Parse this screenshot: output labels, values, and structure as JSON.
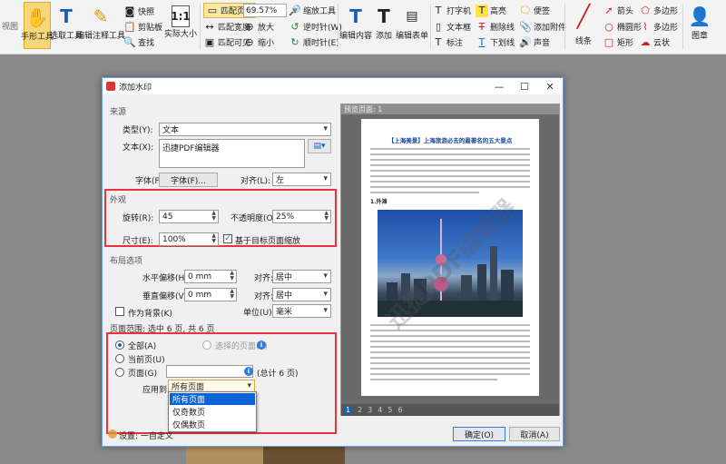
{
  "ribbon": {
    "view_label": "视图",
    "hand_tool": "手形工具",
    "select_tool": "选取工具",
    "annot_select_tool": "编辑注释工具",
    "snapshot": "快照",
    "clipboard": "剪贴板",
    "find": "查找",
    "actual_size": "实际大小",
    "fit_page": "匹配页面",
    "fit_width": "匹配宽度",
    "fit_visible": "匹配可见",
    "zoom_value": "69.57%",
    "zoom_tool": "缩放工具",
    "zoom_in": "放大",
    "zoom_out": "缩小",
    "rotate_ccw": "逆时针(W)",
    "rotate_cw": "顺时针(E)",
    "edit_content": "编辑内容",
    "add": "添加",
    "edit_form": "编辑表单",
    "typewriter": "打字机",
    "textbox": "文本框",
    "callout": "标注",
    "highlight": "高亮",
    "strikeout": "删除线",
    "underline": "下划线",
    "note": "便签",
    "attach": "添加附件",
    "sound": "声音",
    "line": "线条",
    "arrow": "箭头",
    "oval": "椭圆形",
    "rect": "矩形",
    "polygon": "多边形",
    "polyline": "多边形",
    "cloud": "云状",
    "stamp": "图章"
  },
  "dialog": {
    "title": "添加水印",
    "source": {
      "section": "来源",
      "type_label": "类型(Y):",
      "type_value": "文本",
      "text_label": "文本(X):",
      "text_value": "迅捷PDF编辑器",
      "font_label": "字体(F):",
      "font_button": "字体(F)...",
      "align_label": "对齐(L):",
      "align_value": "左"
    },
    "appearance": {
      "section": "外观",
      "rotation_label": "旋转(R):",
      "rotation_value": "45",
      "opacity_label": "不透明度(O):",
      "opacity_value": "25%",
      "size_label": "尺寸(E):",
      "size_value": "100%",
      "scale_label": "基于目标页面缩放"
    },
    "layout": {
      "section": "布局选项",
      "hoffset_label": "水平偏移(H):",
      "hoffset_value": "0 mm",
      "voffset_label": "垂直偏移(V):",
      "voffset_value": "0 mm",
      "halign_label": "对齐:",
      "halign_value": "居中",
      "valign_label": "对齐:",
      "valign_value": "居中",
      "background_label": "作为背景(K)",
      "unit_label": "单位(U):",
      "unit_value": "毫米"
    },
    "range": {
      "section": "页面范围: 选中 6 页, 共 6 页",
      "all": "全部(A)",
      "selected": "选择的页面(S)",
      "current": "当前页(U)",
      "pages": "页面(G)",
      "total": "(总计 6 页)",
      "apply_label": "应用到:",
      "apply_value": "所有页面",
      "options": [
        "所有页面",
        "仅奇数页",
        "仅偶数页"
      ]
    },
    "settings": "设置: 一自定义",
    "ok": "确定(O)",
    "cancel": "取消(A)",
    "preview": {
      "label": "预览页面: 1",
      "heading": "【上海美景】上海旅游必去的最著名的五大景点",
      "sub1": "1.外滩",
      "watermark": "迅捷PDF编辑器",
      "pages": [
        "1",
        "2",
        "3",
        "4",
        "5",
        "6"
      ]
    }
  }
}
